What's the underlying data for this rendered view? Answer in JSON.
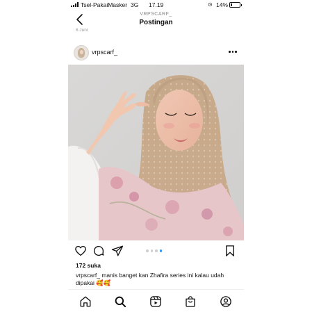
{
  "status_bar": {
    "carrier": "Tsel-PakaiMasker",
    "network": "3G",
    "time": "17.19",
    "battery_percent": "14%",
    "battery_level": 0.14
  },
  "header": {
    "subtitle": "VRPSCARF_",
    "title": "Postingan",
    "previous_post_date": "6 Juni"
  },
  "post": {
    "username": "vrpscarf_",
    "carousel": {
      "count": 4,
      "active_index": 3
    },
    "likes": "172 suka",
    "caption_username": "vrpscarf_",
    "caption_text": " manis banget kan Zhafira series ini kalau udah dipakai ",
    "caption_emoji": "🥰🥰"
  },
  "icons": {
    "back": "chevron-left-icon",
    "more": "more-horizontal-icon",
    "like": "heart-icon",
    "comment": "comment-icon",
    "share": "send-icon",
    "save": "bookmark-icon",
    "nav": [
      "home-icon",
      "search-icon",
      "reels-icon",
      "shop-icon",
      "profile-icon"
    ]
  },
  "colors": {
    "accent": "#3897f0",
    "text": "#111111",
    "muted": "#8e8e8e"
  }
}
